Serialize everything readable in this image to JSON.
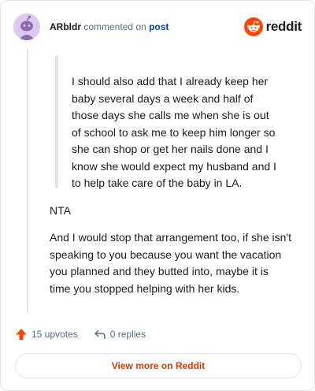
{
  "header": {
    "username": "ARbldr",
    "action_text": "commented on",
    "post_link": "post",
    "brand": "reddit"
  },
  "comment": {
    "quote_lines": [
      "I should also add that I already keep her",
      "baby several days a week and half of",
      "those days she calls me when she is out",
      "of school to ask me to keep him longer so",
      "she can shop or get her nails done and I",
      "know she would expect my husband and I",
      "to help take care of the baby in LA."
    ],
    "verdict": "NTA",
    "body_lines": [
      "And I would stop that arrangement too, if she isn't",
      "speaking to you because you want the vacation",
      "you planned and they butted into, maybe it is",
      "time you stopped helping with her kids."
    ]
  },
  "actions": {
    "upvotes": "15 upvotes",
    "replies": "0 replies"
  },
  "footer": {
    "view_more": "View more on Reddit"
  },
  "colors": {
    "accent": "#ff4500",
    "link": "#0045ac",
    "view_more": "#d93a00"
  },
  "icons": [
    "avatar-icon",
    "reddit-logo-icon",
    "upvote-arrow-icon",
    "reply-arrow-icon"
  ]
}
